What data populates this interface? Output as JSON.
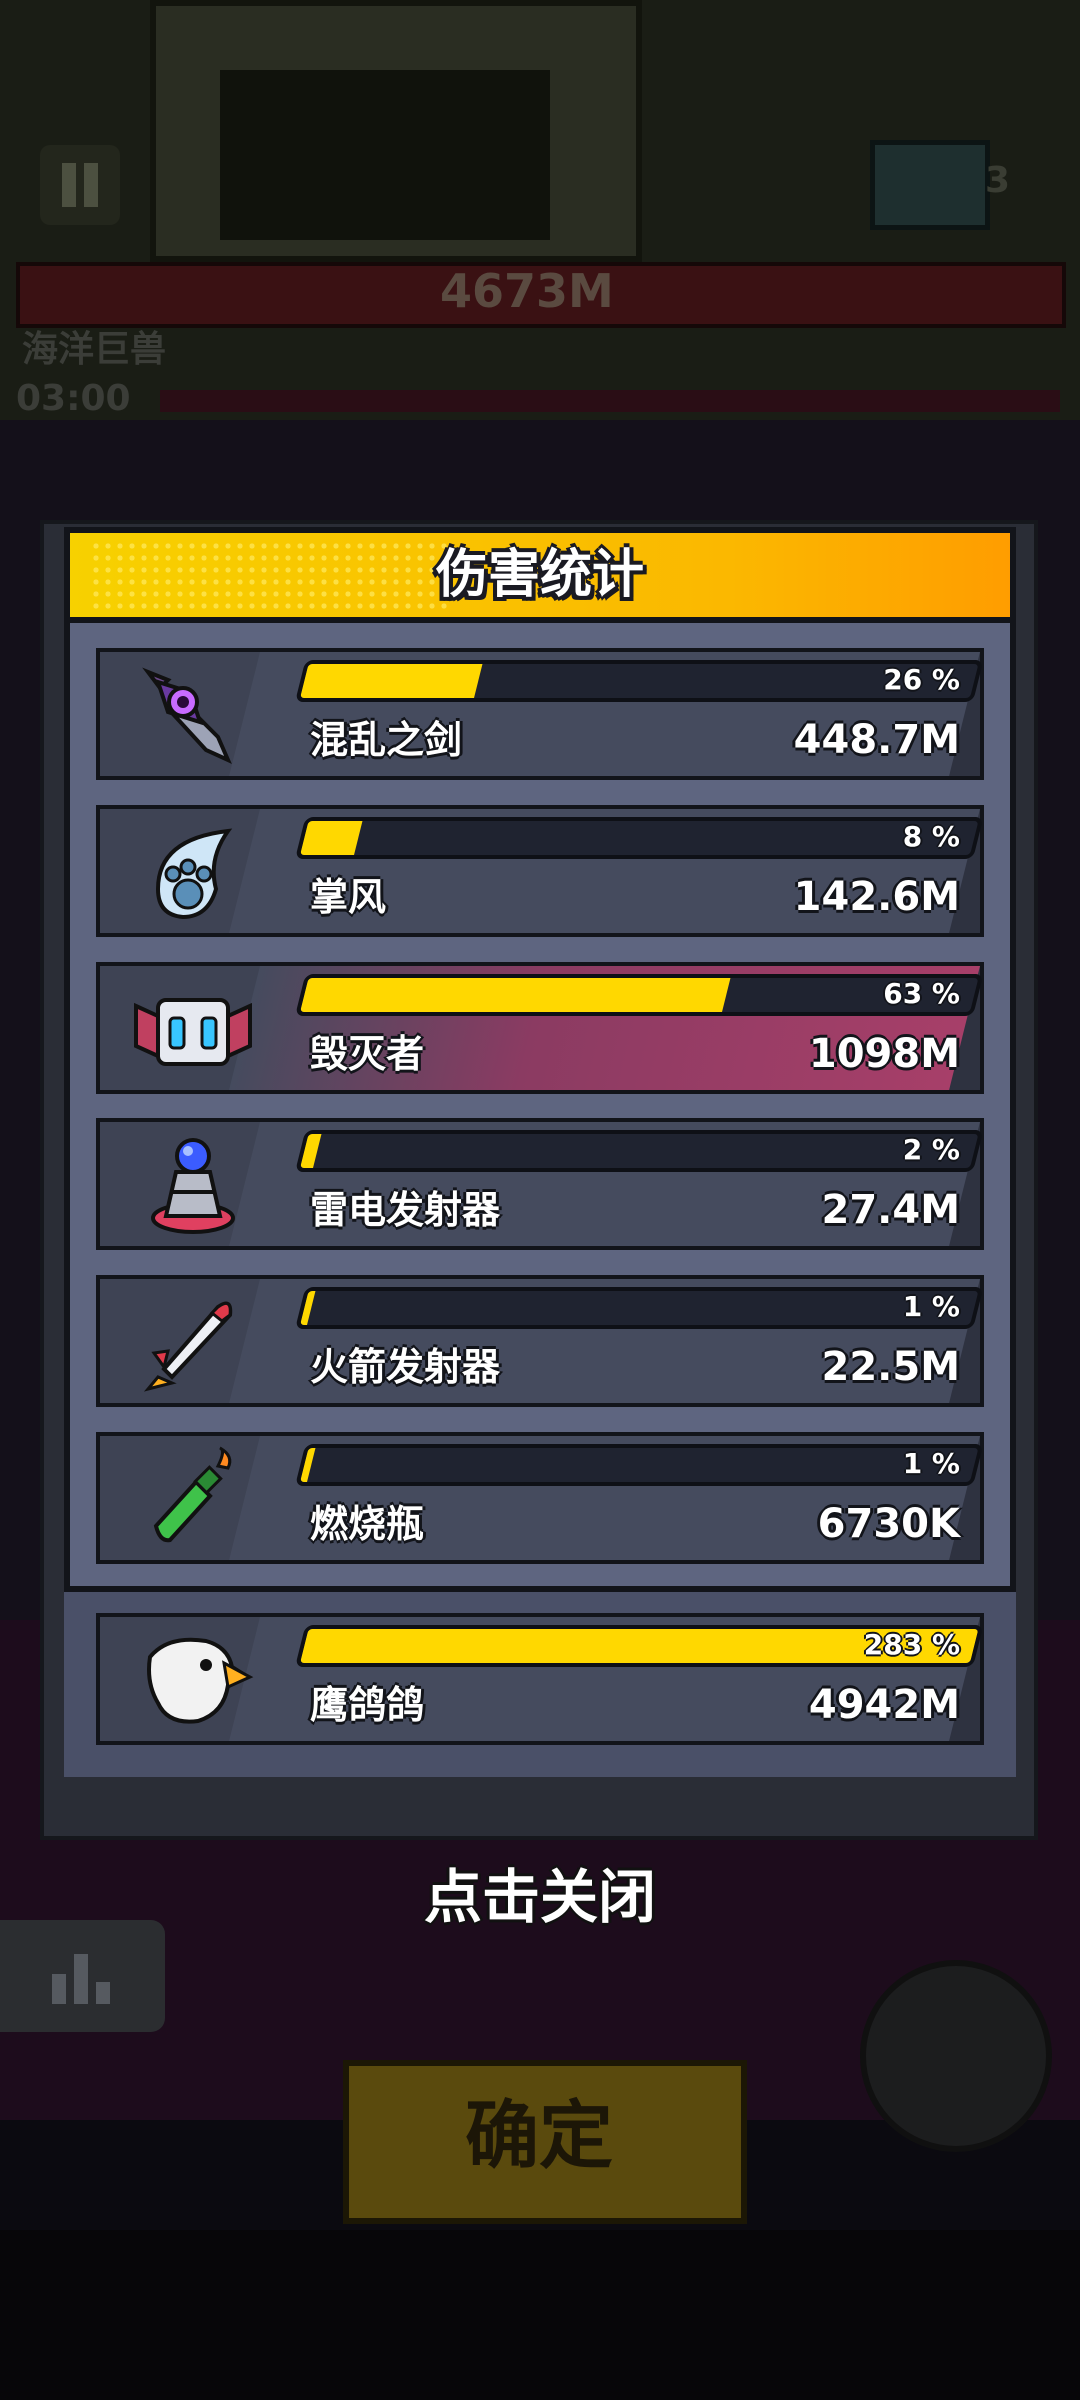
{
  "background": {
    "boss_hp": "4673M",
    "boss_name": "海洋巨兽",
    "timer": "03:00",
    "chest_count": "3",
    "confirm_label": "确定"
  },
  "dialog": {
    "title": "伤害统计",
    "rows": [
      {
        "name": "混乱之剑",
        "value": "448.7M",
        "percent_label": "26 %",
        "percent": 26,
        "icon": "chaos-sword-icon"
      },
      {
        "name": "掌风",
        "value": "142.6M",
        "percent_label": "8 %",
        "percent": 8,
        "icon": "paw-wind-icon"
      },
      {
        "name": "毁灭者",
        "value": "1098M",
        "percent_label": "63 %",
        "percent": 63,
        "icon": "destroyer-robot-icon"
      },
      {
        "name": "雷电发射器",
        "value": "27.4M",
        "percent_label": "2 %",
        "percent": 2,
        "icon": "thunder-launcher-icon"
      },
      {
        "name": "火箭发射器",
        "value": "22.5M",
        "percent_label": "1 %",
        "percent": 1,
        "icon": "rocket-launcher-icon"
      },
      {
        "name": "燃烧瓶",
        "value": "6730K",
        "percent_label": "1 %",
        "percent": 1,
        "icon": "molotov-bottle-icon"
      }
    ],
    "pet": {
      "name": "鹰鸽鸽",
      "value": "4942M",
      "percent_label": "283 %",
      "percent": 100,
      "icon": "eagle-pet-icon"
    }
  },
  "close_hint": "点击关闭",
  "colors": {
    "accent": "#ffd800",
    "header": "#f7d100",
    "panel": "#5e6580"
  }
}
